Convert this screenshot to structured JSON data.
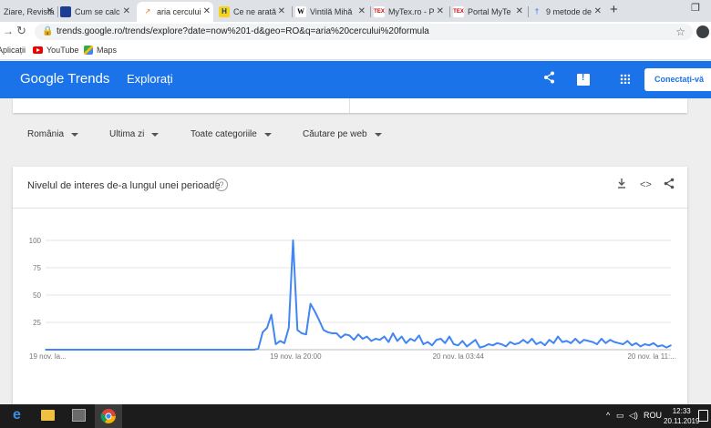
{
  "browser": {
    "tabs": [
      {
        "label": "Ziare, Revista",
        "favicon": "",
        "active": false
      },
      {
        "label": "Cum se calc",
        "favicon": "",
        "active": false
      },
      {
        "label": "aria cercului",
        "favicon": "",
        "active": true
      },
      {
        "label": "Ce ne arată",
        "favicon": "H",
        "active": false
      },
      {
        "label": "Vintilă Mihă",
        "favicon": "W",
        "active": false
      },
      {
        "label": "MyTex.ro - P",
        "favicon": "",
        "active": false
      },
      {
        "label": "Portal MyTe",
        "favicon": "",
        "active": false
      },
      {
        "label": "9 metode de",
        "favicon": "†",
        "active": false
      }
    ],
    "new_tab": "+",
    "url": "trends.google.ro/trends/explore?date=now%201-d&geo=RO&q=aria%20cercului%20formula",
    "bookmarks": [
      "Aplicații",
      "YouTube",
      "Maps"
    ]
  },
  "header": {
    "logo": "Google Trends",
    "section": "Explorați",
    "signin_label": "Conectați-vă"
  },
  "filters": [
    "România",
    "Ultima zi",
    "Toate categoriile",
    "Căutare pe web"
  ],
  "card": {
    "title": "Nivelul de interes de-a lungul unei perioade",
    "help": "?"
  },
  "chart_data": {
    "type": "line",
    "ylim": [
      0,
      100
    ],
    "yticks": [
      "100",
      "75",
      "50",
      "25"
    ],
    "xtick_labels": [
      "19 nov. la...",
      "19 nov. la 20:00",
      "20 nov. la 03:44",
      "20 nov. la 11:..."
    ],
    "x": [
      0,
      1,
      2,
      3,
      4,
      5,
      6,
      7,
      8,
      9,
      10,
      11,
      12,
      13,
      14,
      15,
      16,
      17,
      18,
      19,
      20,
      21,
      22,
      23,
      24,
      25,
      26,
      27,
      28,
      29,
      30,
      31,
      32,
      33,
      34,
      35,
      36,
      37,
      38,
      39,
      40,
      41,
      42,
      43,
      44,
      45,
      46,
      47,
      48,
      49,
      50,
      51,
      52,
      53,
      54,
      55,
      56,
      57,
      58,
      59,
      60,
      61,
      62,
      63,
      64,
      65,
      66,
      67,
      68,
      69,
      70,
      71,
      72,
      73,
      74,
      75,
      76,
      77,
      78,
      79,
      80,
      81,
      82,
      83,
      84,
      85,
      86,
      87,
      88,
      89,
      90,
      91,
      92,
      93,
      94,
      95,
      96,
      97,
      98,
      99,
      100,
      101,
      102,
      103,
      104,
      105,
      106,
      107,
      108,
      109,
      110,
      111,
      112,
      113,
      114,
      115,
      116,
      117,
      118,
      119,
      120,
      121,
      122,
      123,
      124,
      125,
      126,
      127,
      128,
      129,
      130,
      131,
      132,
      133,
      134,
      135,
      136,
      137,
      138,
      139,
      140,
      141,
      142,
      143,
      144
    ],
    "series": [
      {
        "values": [
          0,
          0,
          0,
          0,
          0,
          0,
          0,
          0,
          0,
          0,
          0,
          0,
          0,
          0,
          0,
          0,
          0,
          0,
          0,
          0,
          0,
          0,
          0,
          0,
          0,
          0,
          0,
          0,
          0,
          0,
          0,
          0,
          0,
          0,
          0,
          0,
          0,
          0,
          0,
          0,
          0,
          0,
          0,
          0,
          0,
          0,
          0,
          0,
          0,
          1,
          16,
          20,
          32,
          5,
          8,
          6,
          20,
          100,
          18,
          15,
          14,
          42,
          35,
          27,
          18,
          16,
          15,
          15,
          11,
          14,
          13,
          9,
          14,
          10,
          12,
          8,
          10,
          9,
          12,
          7,
          15,
          8,
          12,
          6,
          10,
          8,
          13,
          5,
          7,
          4,
          9,
          10,
          6,
          12,
          5,
          4,
          8,
          3,
          6,
          9,
          2,
          3,
          5,
          4,
          6,
          5,
          3,
          7,
          5,
          6,
          9,
          6,
          10,
          5,
          7,
          4,
          9,
          6,
          12,
          7,
          8,
          6,
          10,
          6,
          9,
          8,
          7,
          5,
          10,
          6,
          9,
          7,
          6,
          5,
          8,
          4,
          6,
          3,
          5,
          4,
          6,
          3,
          4,
          2,
          4
        ]
      }
    ],
    "grid": true
  },
  "taskbar": {
    "tray": [
      "ROU"
    ],
    "time": "12:33",
    "date": "20.11.2019"
  }
}
